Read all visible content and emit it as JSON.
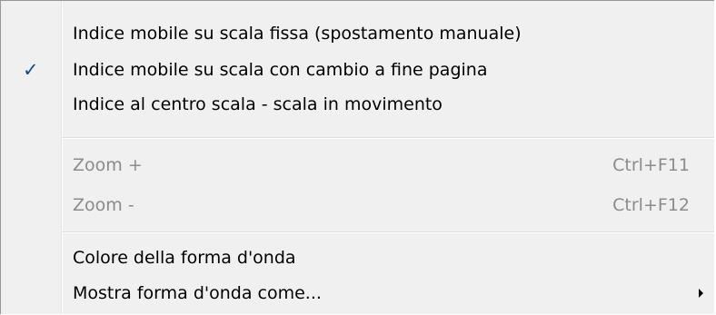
{
  "menu": {
    "items": [
      {
        "label": "Indice mobile su scala fissa (spostamento manuale)",
        "checked": false,
        "disabled": false
      },
      {
        "label": "Indice mobile su scala con cambio a fine pagina",
        "checked": true,
        "check_glyph": "✓",
        "disabled": false
      },
      {
        "label": "Indice al centro scala - scala in movimento",
        "checked": false,
        "disabled": false
      },
      {
        "label": "Zoom +",
        "shortcut": "Ctrl+F11",
        "disabled": true
      },
      {
        "label": "Zoom -",
        "shortcut": "Ctrl+F12",
        "disabled": true
      },
      {
        "label": "Colore della forma d'onda",
        "disabled": false
      },
      {
        "label": "Mostra forma d'onda come...",
        "has_submenu": true,
        "disabled": false
      }
    ]
  },
  "colors": {
    "background": "#f0f0f0",
    "disabled_text": "#8b8b8b",
    "check": "#1a4a8c"
  }
}
